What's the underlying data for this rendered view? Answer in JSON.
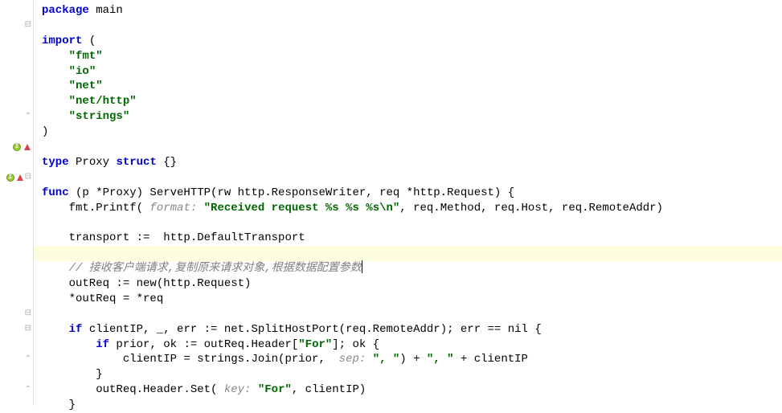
{
  "keywords": {
    "pkg": "package",
    "imp": "import",
    "typ": "type",
    "str": "struct",
    "fun": "func",
    "if": "if"
  },
  "idents": {
    "main": "main",
    "Proxy": "Proxy"
  },
  "imports": [
    "\"fmt\"",
    "\"io\"",
    "\"net\"",
    "\"net/http\"",
    "\"strings\""
  ],
  "openParen": "(",
  "closeParen": ")",
  "structDecl": " {}",
  "funcSig": " (p *Proxy) ServeHTTP(rw http.ResponseWriter, req *http.Request) {",
  "printf1": "    fmt.Printf(",
  "printfHint": " format: ",
  "printfStr": "\"Received request %s %s %s\\n\"",
  "printf2": ", req.Method, req.Host, req.RemoteAddr)",
  "transport": "    transport :=  http.DefaultTransport",
  "comment": "    // 接收客户端请求,复制原来请求对象,根据数据配置参数",
  "outReq1": "    outReq := new(http.Request)",
  "outReq2": "    *outReq = *req",
  "if1a": "    ",
  "if1b": " clientIP, _, err := net.SplitHostPort(req.RemoteAddr); err == nil {",
  "if2a": "        ",
  "if2b": " prior, ok := outReq.Header[",
  "forStr": "\"For\"",
  "if2c": "]; ok {",
  "join1": "            clientIP = strings.Join(prior, ",
  "sepHint": " sep: ",
  "sepStr": "\", \"",
  "join2": ") + ",
  "plusStr": "\", \"",
  "join3": " + clientIP",
  "brace1": "        }",
  "set1": "        outReq.Header.Set(",
  "keyHint": " key: ",
  "set2": ", clientIP)",
  "brace2": "    }"
}
